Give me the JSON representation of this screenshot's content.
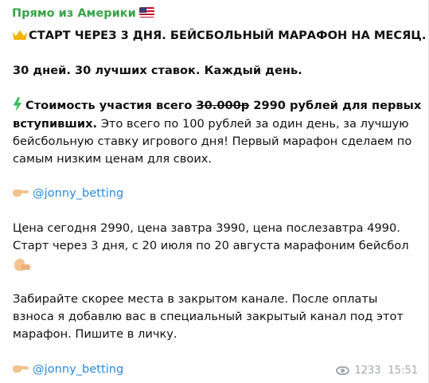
{
  "channel": {
    "name": "Прямо из Америки",
    "flag_icon": "us-flag-icon"
  },
  "post": {
    "headline": "СТАРТ ЧЕРЕЗ 3 ДНЯ. БЕЙСБОЛЬНЫЙ МАРАФОН НА МЕСЯЦ.",
    "tagline": "30 дней. 30 лучших ставок. Каждый день.",
    "price_prefix": "Стоимость участия всего ",
    "old_price": "30.000р",
    "new_price_a": " 2990 рублей для первых",
    "new_price_b": "вступивших.",
    "desc_line1": " Это всего по 100 рублей за один день, за лучшую",
    "desc_line2": "бейсбольную ставку игрового дня! Первый марафон сделаем по",
    "desc_line3": "самым низким ценам для своих.",
    "link1": "@jonny_betting",
    "schedule_line1": "Цена сегодня 2990, цена завтра 3990, цена послезавтра 4990.",
    "schedule_line2": "Старт через 3 дня, с 20 июля по 20 августа марафоним бейсбол",
    "cta_line1": "Забирайте скорее места в закрытом канале. После оплаты",
    "cta_line2": "взноса я добавлю вас в специальный закрытый канал под этот",
    "cta_line3": "марафон. Пишите в личку.",
    "link2": "@jonny_betting"
  },
  "meta": {
    "views": "1233",
    "time": "15:51"
  },
  "colors": {
    "channel_name": "#3aa24a",
    "link": "#2a8ad8",
    "meta": "#a3a8ad"
  }
}
